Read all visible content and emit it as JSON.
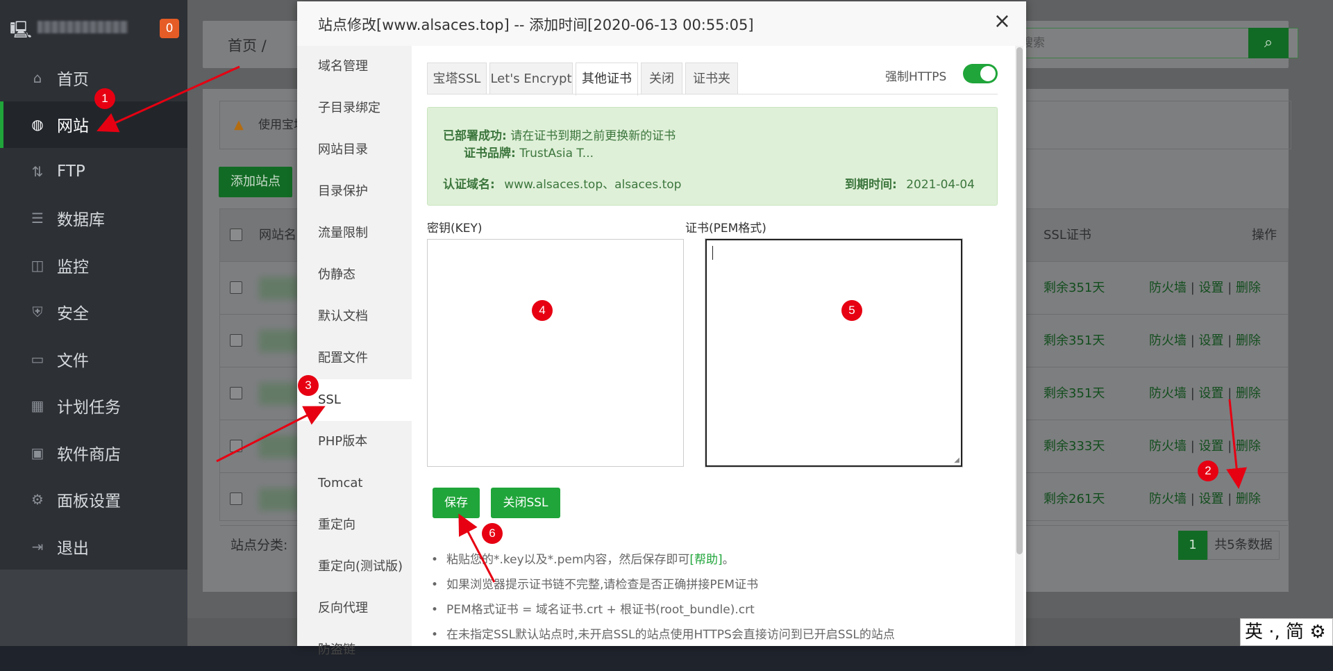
{
  "sidebar": {
    "badge": "0",
    "items": [
      {
        "label": "首页",
        "icon": "home-icon",
        "glyph": "⌂"
      },
      {
        "label": "网站",
        "icon": "globe-icon",
        "glyph": "◍"
      },
      {
        "label": "FTP",
        "icon": "ftp-icon",
        "glyph": "⇅"
      },
      {
        "label": "数据库",
        "icon": "database-icon",
        "glyph": "☰"
      },
      {
        "label": "监控",
        "icon": "monitor-icon",
        "glyph": "◫"
      },
      {
        "label": "安全",
        "icon": "shield-icon",
        "glyph": "⛨"
      },
      {
        "label": "文件",
        "icon": "folder-icon",
        "glyph": "▭"
      },
      {
        "label": "计划任务",
        "icon": "calendar-icon",
        "glyph": "▦"
      },
      {
        "label": "软件商店",
        "icon": "apps-icon",
        "glyph": "▣"
      },
      {
        "label": "面板设置",
        "icon": "gear-icon",
        "glyph": "⚙"
      },
      {
        "label": "退出",
        "icon": "logout-icon",
        "glyph": "⇥"
      }
    ]
  },
  "background": {
    "breadcrumb": "首页  /",
    "search_placeholder": "搜索",
    "warning_text": "使用宝塔",
    "add_site_button": "添加站点",
    "col_name": "网站名",
    "col_ssl": "SSL证书",
    "col_ops": "操作",
    "rows": [
      {
        "ssl": "剩余351天"
      },
      {
        "ssl": "剩余351天"
      },
      {
        "ssl": "剩余351天"
      },
      {
        "ssl": "剩余333天"
      },
      {
        "ssl": "剩余261天"
      }
    ],
    "op_firewall": "防火墙",
    "op_settings": "设置",
    "op_delete": "删除",
    "category_label": "站点分类:",
    "page": "1",
    "total": "共5条数据"
  },
  "modal": {
    "title": "站点修改[www.alsaces.top] -- 添加时间[2020-06-13 00:55:05]",
    "close": "×",
    "nav": [
      "域名管理",
      "子目录绑定",
      "网站目录",
      "目录保护",
      "流量限制",
      "伪静态",
      "默认文档",
      "配置文件",
      "SSL",
      "PHP版本",
      "Tomcat",
      "重定向",
      "重定向(测试版)",
      "反向代理",
      "防盗链"
    ],
    "active_nav": "SSL",
    "tabs": [
      "宝塔SSL",
      "Let's Encrypt",
      "其他证书",
      "关闭",
      "证书夹"
    ],
    "active_tab": "其他证书",
    "force_https_label": "强制HTTPS",
    "force_https_on": true,
    "alert": {
      "deployed_label": "已部署成功:",
      "deployed_text": "请在证书到期之前更换新的证书",
      "brand_label": "证书品牌:",
      "brand_value": "TrustAsia T...",
      "domain_label": "认证域名:",
      "domain_value": "www.alsaces.top、alsaces.top",
      "expire_label": "到期时间:",
      "expire_value": "2021-04-04"
    },
    "key_label": "密钥(KEY)",
    "pem_label": "证书(PEM格式)",
    "key_value": "",
    "pem_value": "",
    "save_button": "保存",
    "close_ssl_button": "关闭SSL",
    "tips": {
      "tip1_a": "粘贴您的*.key以及*.pem内容，然后保存即可",
      "tip1_link": "[帮助]",
      "tip1_b": "。",
      "tip2": "如果浏览器提示证书链不完整,请检查是否正确拼接PEM证书",
      "tip3": "PEM格式证书 = 域名证书.crt + 根证书(root_bundle).crt",
      "tip4": "在未指定SSL默认站点时,未开启SSL的站点使用HTTPS会直接访问到已开启SSL的站点"
    }
  },
  "annotations": [
    "1",
    "2",
    "3",
    "4",
    "5",
    "6"
  ],
  "ime_text": "英 ·, 简 ⚙",
  "colors": {
    "accent": "#20a53a",
    "annotation": "#e60012",
    "sidebar": "#2d3035"
  }
}
